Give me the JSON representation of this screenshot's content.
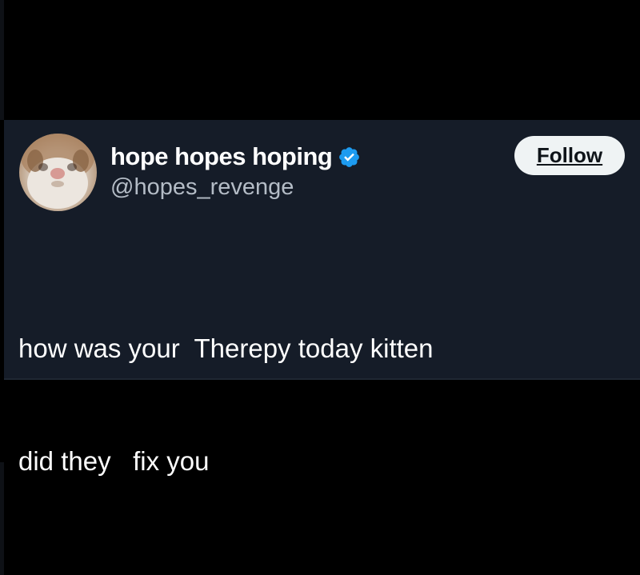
{
  "tweet": {
    "display_name": "hope hopes hoping",
    "handle": "@hopes_revenge",
    "verified": true,
    "follow_label": "Follow",
    "text_lines": [
      "how was your  Therepy today kitten",
      "did they   fix you"
    ],
    "avatar": "hamster-face-avatar"
  },
  "colors": {
    "background": "#000000",
    "card": "#151c28",
    "verified_badge": "#1d9bf0",
    "handle_text": "#b4bcc6",
    "follow_button_bg": "#eff3f4"
  }
}
